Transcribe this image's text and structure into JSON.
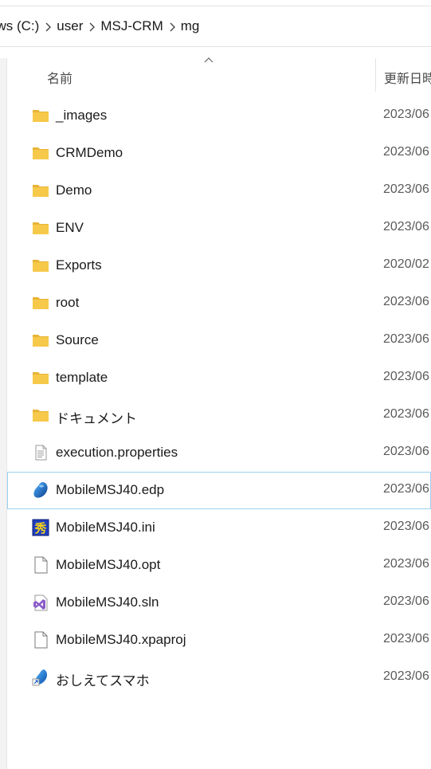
{
  "breadcrumb": {
    "items": [
      "ows (C:)",
      "user",
      "MSJ-CRM",
      "mg"
    ]
  },
  "columns": {
    "name": "名前",
    "date": "更新日時"
  },
  "colors": {
    "folder": "#f6c94a",
    "folder_dark": "#e8b437",
    "selection_border": "#99d1f0"
  },
  "files": [
    {
      "name": "_images",
      "date": "2023/06",
      "icon": "folder-icon"
    },
    {
      "name": "CRMDemo",
      "date": "2023/06",
      "icon": "folder-icon"
    },
    {
      "name": "Demo",
      "date": "2023/06",
      "icon": "folder-icon"
    },
    {
      "name": "ENV",
      "date": "2023/06",
      "icon": "folder-icon"
    },
    {
      "name": "Exports",
      "date": "2020/02",
      "icon": "folder-icon"
    },
    {
      "name": "root",
      "date": "2023/06",
      "icon": "folder-icon"
    },
    {
      "name": "Source",
      "date": "2023/06",
      "icon": "folder-icon"
    },
    {
      "name": "template",
      "date": "2023/06",
      "icon": "folder-icon"
    },
    {
      "name": "ドキュメント",
      "date": "2023/06",
      "icon": "folder-icon"
    },
    {
      "name": "execution.properties",
      "date": "2023/06",
      "icon": "text-file-icon"
    },
    {
      "name": "MobileMSJ40.edp",
      "date": "2023/06",
      "icon": "edp-file-icon",
      "selected": true
    },
    {
      "name": "MobileMSJ40.ini",
      "date": "2023/06",
      "icon": "ini-file-icon"
    },
    {
      "name": "MobileMSJ40.opt",
      "date": "2023/06",
      "icon": "blank-file-icon"
    },
    {
      "name": "MobileMSJ40.sln",
      "date": "2023/06",
      "icon": "visual-studio-solution-icon"
    },
    {
      "name": "MobileMSJ40.xpaproj",
      "date": "2023/06",
      "icon": "blank-file-icon"
    },
    {
      "name": "おしえてスマホ",
      "date": "2023/06",
      "icon": "shortcut-icon"
    }
  ]
}
